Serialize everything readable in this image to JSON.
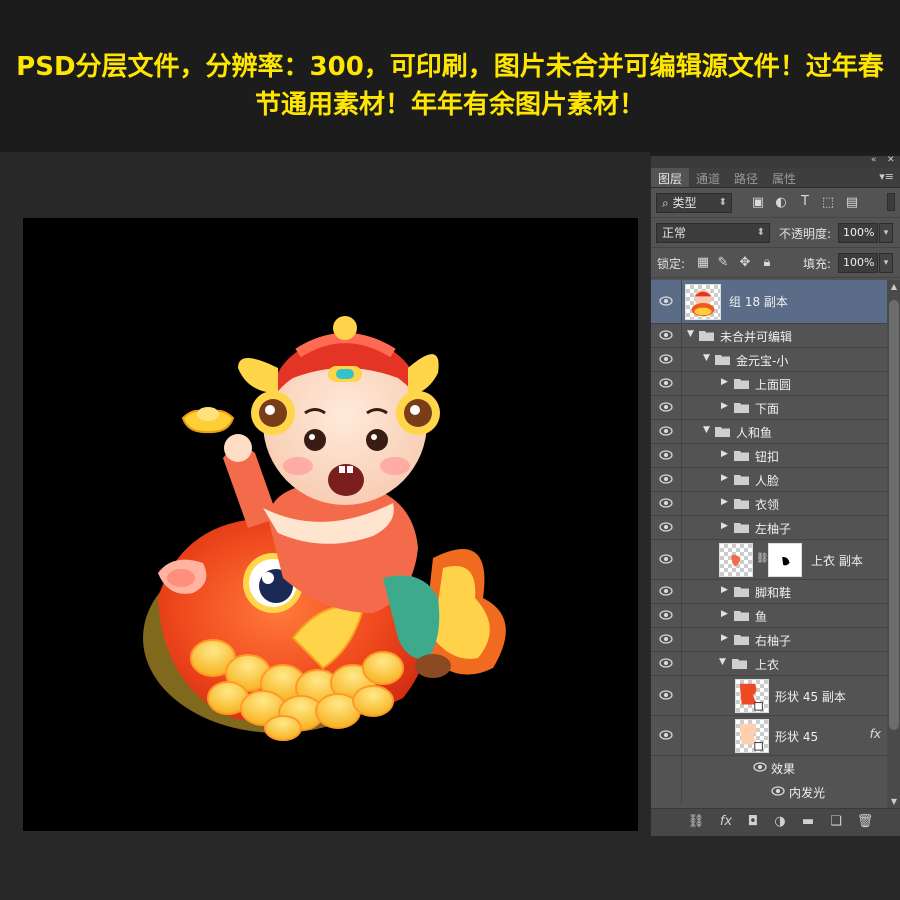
{
  "banner": {
    "line1": "PSD分层文件，分辨率：300，可印刷，图片未合并可编辑源文件！过年春",
    "line2": "节通用素材！年年有余图片素材！"
  },
  "panel": {
    "tabs": [
      "图层",
      "通道",
      "路径",
      "属性"
    ],
    "filter_label": "类型",
    "blend_mode": "正常",
    "opacity_label": "不透明度:",
    "opacity_value": "100%",
    "lock_label": "锁定:",
    "fill_label": "填充:",
    "fill_value": "100%",
    "filter_icons": [
      "image-filter-icon",
      "adjustment-filter-icon",
      "type-filter-icon",
      "shape-filter-icon",
      "smart-object-filter-icon"
    ],
    "lock_icons": [
      "lock-transparent-icon",
      "lock-paint-icon",
      "lock-position-icon",
      "lock-all-icon"
    ],
    "bottom_icons": [
      "link-layers-icon",
      "fx-icon",
      "mask-icon",
      "adjustment-icon",
      "new-group-icon",
      "new-layer-icon",
      "delete-icon"
    ]
  },
  "layers": [
    {
      "name": "组 18 副本",
      "kind": "thumb-top"
    },
    {
      "name": "未合并可编辑",
      "kind": "group-open",
      "indent": 0
    },
    {
      "name": "金元宝-小",
      "kind": "group-open",
      "indent": 1
    },
    {
      "name": "上面圆",
      "kind": "group",
      "indent": 2
    },
    {
      "name": "下面",
      "kind": "group",
      "indent": 2
    },
    {
      "name": "人和鱼",
      "kind": "group-open",
      "indent": 1
    },
    {
      "name": "钮扣",
      "kind": "group",
      "indent": 2
    },
    {
      "name": "人脸",
      "kind": "group",
      "indent": 2
    },
    {
      "name": "衣领",
      "kind": "group",
      "indent": 2
    },
    {
      "name": "左柚子",
      "kind": "group",
      "indent": 2
    },
    {
      "name": "上衣 副本",
      "kind": "masked"
    },
    {
      "name": "脚和鞋",
      "kind": "group",
      "indent": 2
    },
    {
      "name": "鱼",
      "kind": "group",
      "indent": 2
    },
    {
      "name": "右柚子",
      "kind": "group",
      "indent": 2
    },
    {
      "name": "上衣",
      "kind": "group-open",
      "indent": 2
    },
    {
      "name": "形状 45 副本",
      "kind": "shape"
    },
    {
      "name": "形状 45",
      "kind": "shape-fx"
    },
    {
      "name": "效果",
      "kind": "effect"
    },
    {
      "name": "内发光",
      "kind": "effect-sub"
    }
  ],
  "fx_label": "fx",
  "colors": {
    "banner_text": "#ffe600",
    "selected_layer": "#5a6c87",
    "panel_bg": "#535353"
  }
}
